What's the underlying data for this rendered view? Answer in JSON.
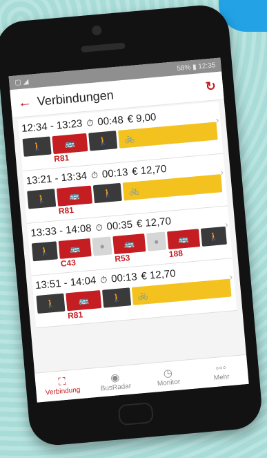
{
  "status_bar": {
    "left": "▢ ◢",
    "right": "58% ▮ 12:35"
  },
  "header": {
    "title": "Verbindungen"
  },
  "icons": {
    "back": "arrow-left-icon",
    "refresh": "refresh-icon"
  },
  "connections": [
    {
      "time": "12:34 - 13:23",
      "duration": "00:48",
      "price": "€ 9,00",
      "segments": [
        {
          "type": "walk",
          "icon": "🚶"
        },
        {
          "type": "bus",
          "icon": "🚌",
          "label": "R81"
        },
        {
          "type": "walk",
          "icon": "🚶"
        },
        {
          "type": "bike",
          "icon": "🚲"
        }
      ]
    },
    {
      "time": "13:21 - 13:34",
      "duration": "00:13",
      "price": "€ 12,70",
      "segments": [
        {
          "type": "walk",
          "icon": "🚶"
        },
        {
          "type": "bus",
          "icon": "🚌",
          "label": "R81"
        },
        {
          "type": "walk",
          "icon": "🚶"
        },
        {
          "type": "bike",
          "icon": "🚲"
        }
      ]
    },
    {
      "time": "13:33 - 14:08",
      "duration": "00:35",
      "price": "€ 12,70",
      "segments": [
        {
          "type": "walk",
          "icon": "🚶"
        },
        {
          "type": "bus",
          "icon": "🚌",
          "label": "C43"
        },
        {
          "type": "wait",
          "icon": "●"
        },
        {
          "type": "bus",
          "icon": "🚌",
          "label": "R53"
        },
        {
          "type": "wait",
          "icon": "●"
        },
        {
          "type": "bus",
          "icon": "🚌",
          "label": "188"
        },
        {
          "type": "walk",
          "icon": "🚶"
        }
      ]
    },
    {
      "time": "13:51 - 14:04",
      "duration": "00:13",
      "price": "€ 12,70",
      "segments": [
        {
          "type": "walk",
          "icon": "🚶"
        },
        {
          "type": "bus",
          "icon": "🚌",
          "label": "R81"
        },
        {
          "type": "walk",
          "icon": "🚶"
        },
        {
          "type": "bike",
          "icon": "🚲"
        }
      ]
    }
  ],
  "tabs": [
    {
      "label": "Verbindung",
      "icon": "⛶",
      "active": true
    },
    {
      "label": "BusRadar",
      "icon": "◉",
      "active": false
    },
    {
      "label": "Monitor",
      "icon": "◷",
      "active": false
    },
    {
      "label": "Mehr",
      "icon": "◦◦◦",
      "active": false
    }
  ]
}
